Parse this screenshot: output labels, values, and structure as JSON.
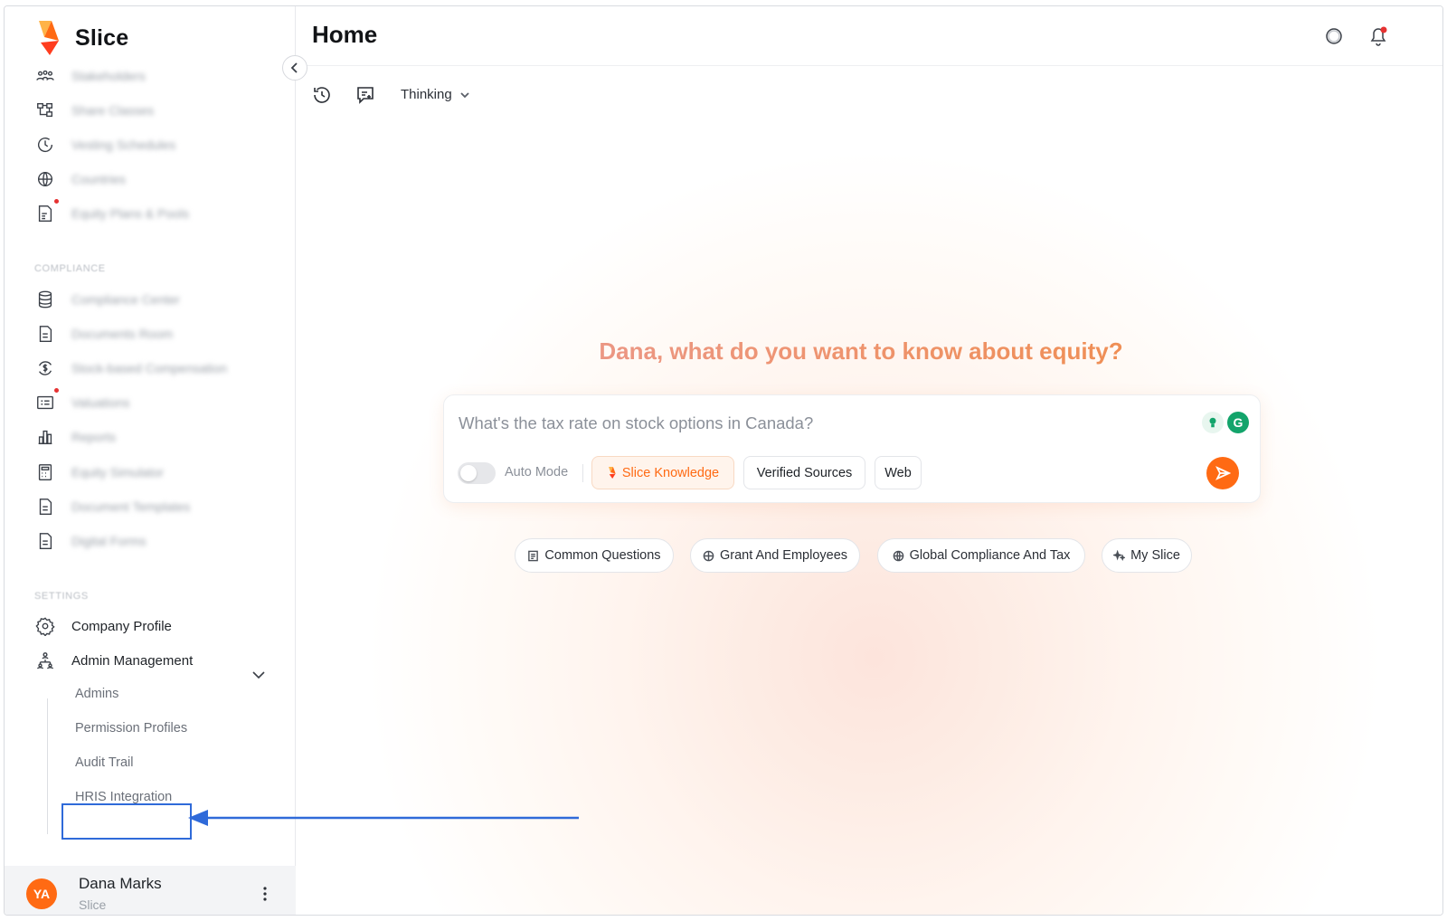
{
  "brand": {
    "name": "Slice"
  },
  "sidebar": {
    "top_items": [
      {
        "label": "Stakeholders",
        "icon": "stakeholders-icon"
      },
      {
        "label": "Share Classes",
        "icon": "hierarchy-icon"
      },
      {
        "label": "Vesting Schedules",
        "icon": "clock-icon"
      },
      {
        "label": "Countries",
        "icon": "globe-icon"
      },
      {
        "label": "Equity Plans & Pools",
        "icon": "document-chart-icon"
      }
    ],
    "compliance_title": "COMPLIANCE",
    "compliance_items": [
      {
        "label": "Compliance Center",
        "icon": "database-icon"
      },
      {
        "label": "Documents Room",
        "icon": "document-icon"
      },
      {
        "label": "Stock-based Compensation",
        "icon": "dollar-cycle-icon"
      },
      {
        "label": "Valuations",
        "icon": "list-card-icon"
      },
      {
        "label": "Reports",
        "icon": "bar-chart-icon"
      },
      {
        "label": "Equity Simulator",
        "icon": "calculator-icon"
      },
      {
        "label": "Document Templates",
        "icon": "document-icon"
      },
      {
        "label": "Digital Forms",
        "icon": "document-icon"
      }
    ],
    "settings_title": "SETTINGS",
    "settings_items": [
      {
        "label": "Company Profile",
        "icon": "gear-icon"
      },
      {
        "label": "Admin Management",
        "icon": "org-chart-icon"
      }
    ],
    "admin_sub_items": [
      "Admins",
      "Permission Profiles",
      "Audit Trail",
      "HRIS Integration"
    ]
  },
  "user": {
    "initials": "YA",
    "name": "Dana Marks",
    "org": "Slice"
  },
  "header": {
    "title": "Home"
  },
  "toolbar": {
    "mode_label": "Thinking"
  },
  "main": {
    "headline": "Dana, what do you want to know about equity?",
    "chat_placeholder": "What's the tax rate on stock options in Canada?",
    "auto_mode_label": "Auto Mode",
    "sources": [
      "Slice Knowledge",
      "Verified Sources",
      "Web"
    ],
    "suggestions": [
      "Common Questions",
      "Grant And Employees",
      "Global Compliance And Tax",
      "My Slice"
    ]
  },
  "colors": {
    "accent": "#ff6a13",
    "highlight_border": "#2f6ad9"
  }
}
